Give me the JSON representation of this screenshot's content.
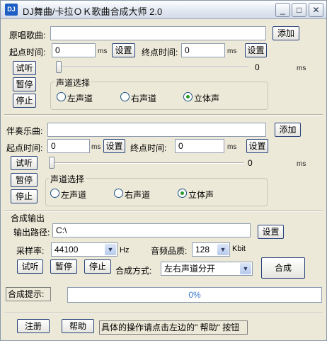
{
  "window": {
    "title": "DJ舞曲/卡拉ＯＫ歌曲合成大师 2.0",
    "icon_text": "DJ",
    "controls": {
      "minimize": "_",
      "maximize": "□",
      "close": "✕"
    }
  },
  "original": {
    "song_label": "原唱歌曲:",
    "song_value": "",
    "add_label": "添加",
    "start_label": "起点时间:",
    "start_value": "0",
    "start_unit": "ms",
    "start_set": "设置",
    "end_label": "终点时间:",
    "end_value": "0",
    "end_unit": "ms",
    "end_set": "设置",
    "listen": "试听",
    "pause": "暂停",
    "stop": "停止",
    "slider_value": "0",
    "slider_unit": "ms",
    "slider_fraction": 0,
    "channel_title": "声道选择",
    "channel_left": "左声道",
    "channel_right": "右声道",
    "channel_stereo": "立体声",
    "channel_selected": "stereo"
  },
  "accompaniment": {
    "song_label": "伴奏乐曲:",
    "song_value": "",
    "add_label": "添加",
    "start_label": "起点时间:",
    "start_value": "0",
    "start_unit": "ms",
    "start_set": "设置",
    "end_label": "终点时间:",
    "end_value": "0",
    "end_unit": "ms",
    "end_set": "设置",
    "listen": "试听",
    "pause": "暂停",
    "stop": "停止",
    "slider_value": "0",
    "slider_unit": "ms",
    "slider_fraction": 0,
    "channel_title": "声道选择",
    "channel_left": "左声道",
    "channel_right": "右声道",
    "channel_stereo": "立体声",
    "channel_selected": "stereo"
  },
  "output": {
    "group_title": "合成输出",
    "path_label": "输出路径:",
    "path_value": "C:\\",
    "path_set": "设置",
    "rate_label": "采样率:",
    "rate_value": "44100",
    "rate_unit": "Hz",
    "quality_label": "音频品质:",
    "quality_value": "128",
    "quality_unit": "Kbit",
    "listen": "试听",
    "pause": "暂停",
    "stop": "停止",
    "mode_label": "合成方式:",
    "mode_value": "左右声道分开",
    "combine": "合成"
  },
  "progress": {
    "label": "合成提示:",
    "value": "0%",
    "fraction": 0
  },
  "footer": {
    "register": "注册",
    "help": "帮助",
    "hint": "具体的操作请点击左边的\" 帮助\" 按钮"
  },
  "colors": {
    "window_bg": "#ece9d8",
    "radio_dot": "#2a9a28",
    "progress_text": "#3a79c9"
  }
}
